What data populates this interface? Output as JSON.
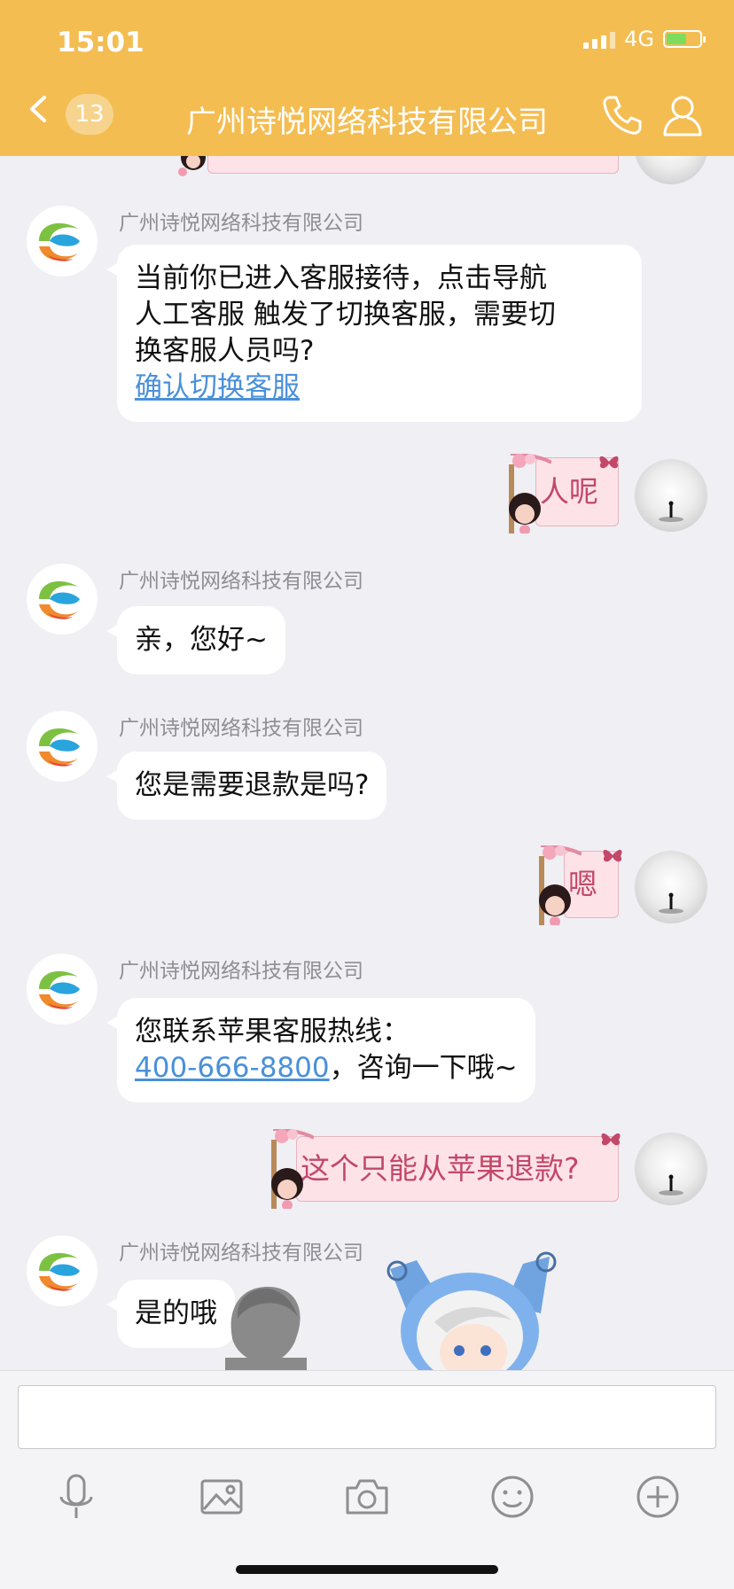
{
  "status_bar": {
    "time": "15:01",
    "network": "4G"
  },
  "header": {
    "title": "广州诗悦网络科技有限公司",
    "unread_count": "13",
    "back_icon": "chevron-left-icon",
    "call_icon": "phone-icon",
    "profile_icon": "person-icon",
    "background_color": "#f4bd52"
  },
  "messages": [
    {
      "side": "left",
      "sender": "广州诗悦网络科技有限公司",
      "lines": [
        "当前你已进入客服接待，点击导航",
        "人工客服 触发了切换客服，需要切",
        "换客服人员吗?"
      ],
      "link_text": "确认切换客服"
    },
    {
      "side": "right",
      "text": "人呢"
    },
    {
      "side": "left",
      "sender": "广州诗悦网络科技有限公司",
      "text": "亲，您好~"
    },
    {
      "side": "left",
      "sender": "广州诗悦网络科技有限公司",
      "text": "您是需要退款是吗?"
    },
    {
      "side": "right",
      "text": "嗯"
    },
    {
      "side": "left",
      "sender": "广州诗悦网络科技有限公司",
      "text_line1": "您联系苹果客服热线：",
      "phone": "400-666-8800",
      "text_after_phone": "，咨询一下哦~"
    },
    {
      "side": "right",
      "text": "这个只能从苹果退款?"
    },
    {
      "side": "left",
      "sender": "广州诗悦网络科技有限公司",
      "text": "是的哦"
    }
  ],
  "input": {
    "placeholder": ""
  },
  "toolbar": {
    "icons": [
      "microphone-icon",
      "image-icon",
      "camera-icon",
      "emoji-icon",
      "plus-icon"
    ]
  }
}
